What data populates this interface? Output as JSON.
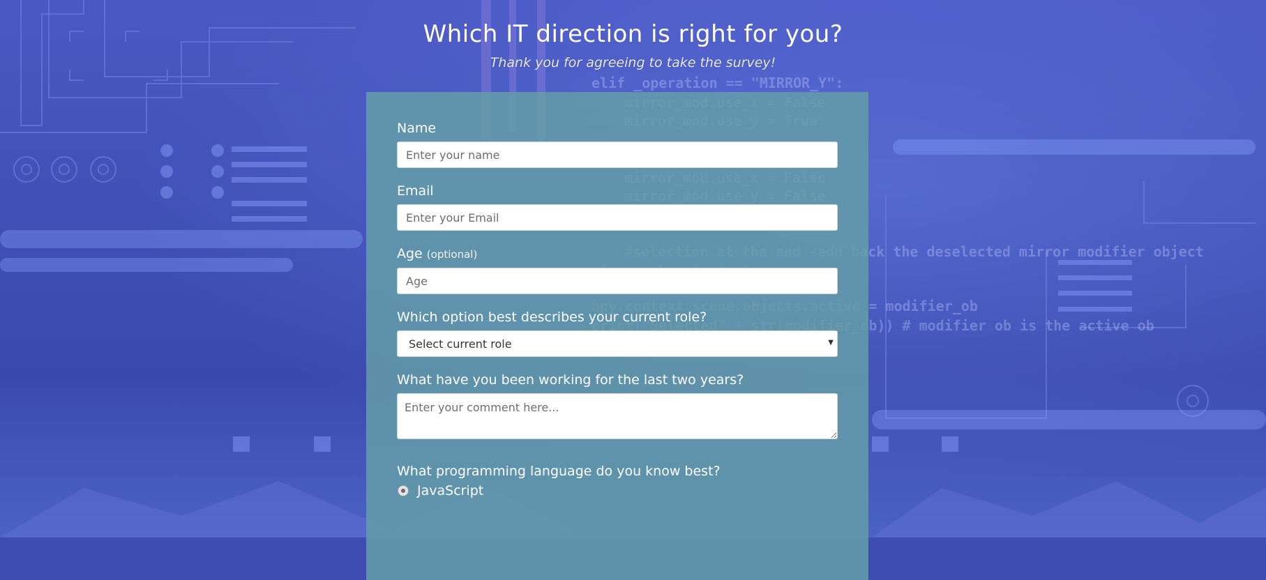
{
  "header": {
    "title": "Which IT direction is right for you?",
    "subtitle": "Thank you for agreeing to take the survey!"
  },
  "form": {
    "name": {
      "label": "Name",
      "placeholder": "Enter your name"
    },
    "email": {
      "label": "Email",
      "placeholder": "Enter your Email"
    },
    "age": {
      "label": "Age",
      "hint": "(optional)",
      "placeholder": "Age"
    },
    "role": {
      "label": "Which option best describes your current role?",
      "selected": "Select current role"
    },
    "work": {
      "label": "What have you been working for the last two years?",
      "placeholder": "Enter your comment here..."
    },
    "language": {
      "label": "What programming language do you know best?",
      "options": [
        "JavaScript"
      ]
    }
  },
  "colors": {
    "background": "#4050b6",
    "card": "#649ea8",
    "text": "#ffffff"
  }
}
